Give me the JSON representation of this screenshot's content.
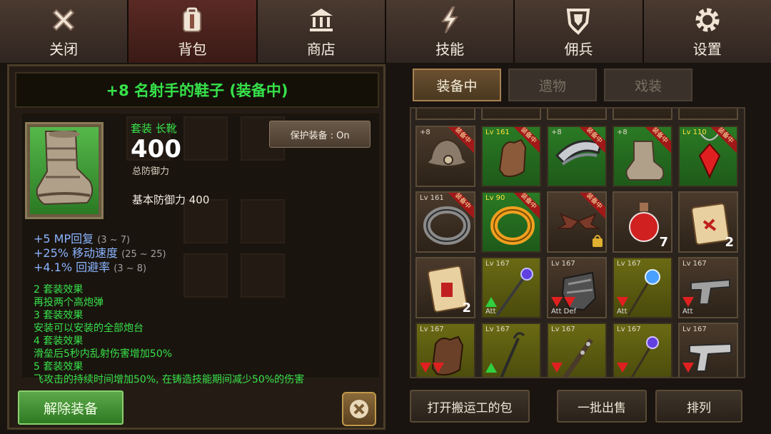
{
  "nav": {
    "tabs": [
      {
        "label": "关闭",
        "icon": "close-icon"
      },
      {
        "label": "背包",
        "icon": "backpack-icon"
      },
      {
        "label": "商店",
        "icon": "shop-icon"
      },
      {
        "label": "技能",
        "icon": "skill-bolt-icon"
      },
      {
        "label": "佣兵",
        "icon": "mercenary-shield-icon"
      },
      {
        "label": "设置",
        "icon": "gear-icon"
      }
    ]
  },
  "item": {
    "title": "+8 名射手的鞋子 (装备中)",
    "set_type": "套装 长靴",
    "defense": "400",
    "defense_caption": "总防御力",
    "base_defense": "基本防御力 400",
    "protect_label": "保护装备 : On",
    "stats": [
      {
        "text": "+5 MP回复",
        "range": "(3 ~ 7)"
      },
      {
        "text": "+25% 移动速度",
        "range": "(25 ~ 25)"
      },
      {
        "text": "+4.1% 回避率",
        "range": "(3 ~ 8)"
      }
    ],
    "set_effects": [
      "2 套装效果",
      "再投两个高炮弹",
      "3 套装效果",
      "安装可以安装的全部炮台",
      "4 套装效果",
      "滑垒后5秒内乱射伤害增加50%",
      "5 套装效果",
      "飞攻击的持续时间增加50%, 在铸造技能期间减少50%的伤害"
    ],
    "unequip_label": "解除装备"
  },
  "inventory": {
    "tabs": [
      "装备中",
      "遗物",
      "戏装"
    ],
    "slots": [
      {
        "lv": "+8",
        "equipped": "装备中",
        "color": "dark",
        "icon": "hat-icon"
      },
      {
        "lv": "Lv 161",
        "equipped": "装备中",
        "color": "green",
        "icon": "glove-icon"
      },
      {
        "lv": "+8",
        "equipped": "装备中",
        "color": "green",
        "icon": "shoulder-armor-icon"
      },
      {
        "lv": "+8",
        "equipped": "装备中",
        "color": "green",
        "icon": "boot-icon"
      },
      {
        "lv": "Lv 110",
        "equipped": "装备中",
        "color": "green",
        "icon": "red-gem-necklace-icon"
      },
      {
        "lv": "Lv 161",
        "equipped": "装备中",
        "color": "dark",
        "icon": "silver-ring-icon"
      },
      {
        "lv": "Lv 90",
        "equipped": "装备中",
        "color": "green",
        "icon": "gold-ring-icon"
      },
      {
        "lv": "",
        "equipped": "装备中",
        "color": "dark",
        "icon": "bat-wings-locked-icon"
      },
      {
        "lv": "",
        "equipped": "",
        "color": "dark",
        "icon": "red-potion-icon",
        "count": "7"
      },
      {
        "lv": "",
        "equipped": "",
        "color": "dark",
        "icon": "scroll-icon",
        "count": "2"
      },
      {
        "lv": "",
        "equipped": "",
        "color": "dark",
        "icon": "red-scroll-icon",
        "count": "2"
      },
      {
        "lv": "Lv 167",
        "equipped": "",
        "color": "yellow",
        "icon": "staff-icon",
        "tag": "Att",
        "arrows": [
          "up"
        ]
      },
      {
        "lv": "Lv 167",
        "equipped": "",
        "color": "dark",
        "icon": "gauntlet-icon",
        "tag": "Att  Def",
        "arrows": [
          "down",
          "down"
        ]
      },
      {
        "lv": "Lv 167",
        "equipped": "",
        "color": "yellow",
        "icon": "orb-wand-icon",
        "tag": "Att",
        "arrows": [
          "down"
        ]
      },
      {
        "lv": "Lv 167",
        "equipped": "",
        "color": "dark",
        "icon": "revolver-icon",
        "tag": "Att",
        "arrows": [
          "down"
        ]
      },
      {
        "lv": "Lv 167",
        "equipped": "",
        "color": "yellow",
        "icon": "leather-glove-icon",
        "tag": "",
        "arrows": [
          "down",
          "down"
        ]
      },
      {
        "lv": "Lv 167",
        "equipped": "",
        "color": "yellow",
        "icon": "hook-staff-icon",
        "tag": "",
        "arrows": [
          "up"
        ]
      },
      {
        "lv": "Lv 167",
        "equipped": "",
        "color": "yellow",
        "icon": "spiked-club-icon",
        "tag": "",
        "arrows": [
          "down"
        ]
      },
      {
        "lv": "Lv 167",
        "equipped": "",
        "color": "yellow",
        "icon": "star-wand-icon",
        "tag": "",
        "arrows": [
          "down"
        ]
      },
      {
        "lv": "Lv 167",
        "equipped": "",
        "color": "dark",
        "icon": "pistol-icon",
        "tag": "",
        "arrows": [
          "down"
        ]
      }
    ]
  },
  "bottom": {
    "open_porter_bag": "打开搬运工的包",
    "bulk_sell": "一批出售",
    "sort": "排列"
  },
  "colors": {
    "set_green": "#36e24a",
    "stat_blue": "#8ab4ff",
    "equipped_red": "#a01818"
  }
}
